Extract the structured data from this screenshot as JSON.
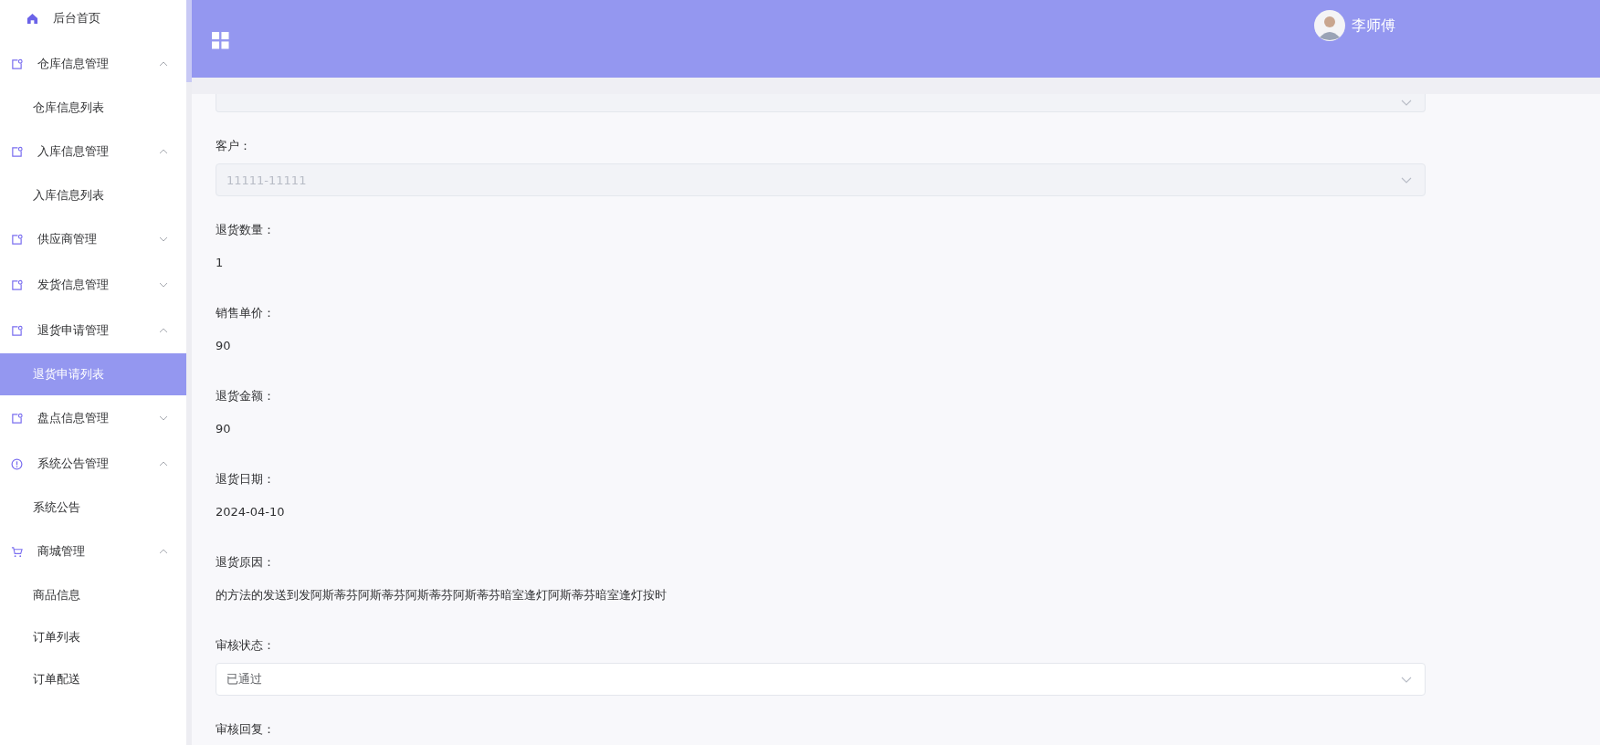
{
  "sidebar": {
    "items": [
      {
        "kind": "home",
        "label": "后台首页"
      },
      {
        "kind": "group",
        "label": "仓库信息管理",
        "expanded": true,
        "children": [
          {
            "label": "仓库信息列表",
            "selected": false
          }
        ]
      },
      {
        "kind": "group",
        "label": "入库信息管理",
        "expanded": true,
        "children": [
          {
            "label": "入库信息列表",
            "selected": false
          }
        ]
      },
      {
        "kind": "group",
        "label": "供应商管理",
        "expanded": false
      },
      {
        "kind": "group",
        "label": "发货信息管理",
        "expanded": false
      },
      {
        "kind": "group",
        "label": "退货申请管理",
        "expanded": true,
        "children": [
          {
            "label": "退货申请列表",
            "selected": true
          }
        ]
      },
      {
        "kind": "group",
        "label": "盘点信息管理",
        "expanded": false
      },
      {
        "kind": "notice-group",
        "label": "系统公告管理",
        "expanded": true,
        "children": [
          {
            "label": "系统公告",
            "selected": false
          }
        ]
      },
      {
        "kind": "cart-group",
        "label": "商城管理",
        "expanded": true,
        "children": [
          {
            "label": "商品信息",
            "selected": false
          },
          {
            "label": "订单列表",
            "selected": false
          },
          {
            "label": "订单配送",
            "selected": false
          }
        ]
      }
    ]
  },
  "header": {
    "user": {
      "name": "李师傅"
    }
  },
  "form": {
    "fields": [
      {
        "kind": "select",
        "disabled": true
      },
      {
        "kind": "select",
        "label": "客户：",
        "value": "11111-11111",
        "disabled": true
      },
      {
        "kind": "text",
        "label": "退货数量：",
        "value": "1"
      },
      {
        "kind": "text",
        "label": "销售单价：",
        "value": "90"
      },
      {
        "kind": "text",
        "label": "退货金额：",
        "value": "90"
      },
      {
        "kind": "text",
        "label": "退货日期：",
        "value": "2024-04-10"
      },
      {
        "kind": "text",
        "label": "退货原因：",
        "value": "的方法的发送到发阿斯蒂芬阿斯蒂芬阿斯蒂芬阿斯蒂芬暗室逢灯阿斯蒂芬暗室逢灯按时"
      },
      {
        "kind": "select",
        "label": "审核状态：",
        "value": "已通过",
        "disabled": false
      },
      {
        "kind": "text",
        "label": "审核回复："
      }
    ]
  }
}
